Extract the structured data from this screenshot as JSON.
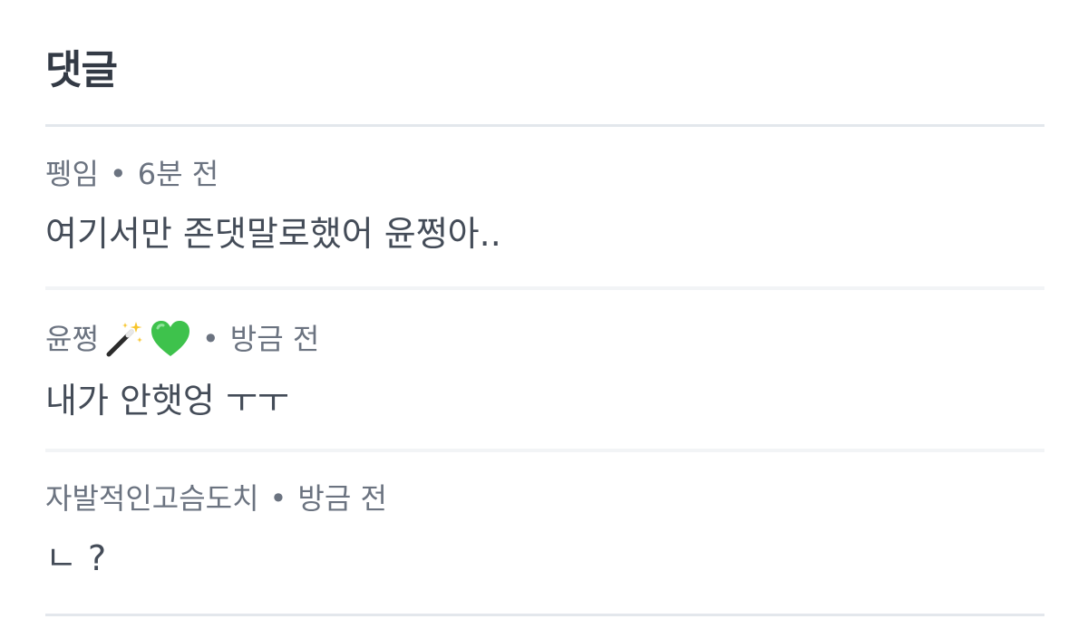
{
  "header": {
    "title": "댓글"
  },
  "comments": [
    {
      "author": "펭임",
      "separator": "•",
      "time": "6분 전",
      "text": "여기서만 존댓말로했어 윤쩡아..",
      "badge_icons": []
    },
    {
      "author": "윤쩡",
      "separator": "•",
      "time": "방금 전",
      "text": "내가 안햇엉 ㅜㅜ",
      "badge_icons": [
        "magic-wand-icon",
        "green-heart-icon"
      ]
    },
    {
      "author": "자발적인고슴도치",
      "separator": "•",
      "time": "방금 전",
      "text": "ㄴ ?",
      "badge_icons": []
    }
  ],
  "colors": {
    "title": "#333a45",
    "meta": "#6b7380",
    "body": "#444c58",
    "divider": "#e3e7ec",
    "green_heart": "#3ec24c"
  }
}
